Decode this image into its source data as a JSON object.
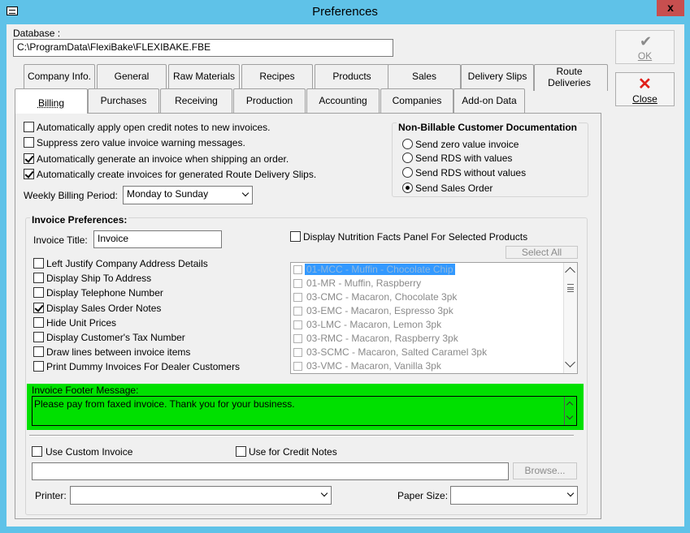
{
  "window": {
    "title": "Preferences",
    "close_glyph": "x"
  },
  "database": {
    "label": "Database :",
    "path": "C:\\ProgramData\\FlexiBake\\FLEXIBAKE.FBE"
  },
  "buttons": {
    "ok_label": "OK",
    "close_label": "Close",
    "select_all": "Select All",
    "browse": "Browse..."
  },
  "tabs_row1": [
    "Company Info.",
    "General",
    "Raw Materials",
    "Recipes",
    "Products",
    "Sales",
    "Delivery Slips",
    "Route Deliveries"
  ],
  "tabs_row2": [
    "Billing",
    "Purchases",
    "Receiving",
    "Production",
    "Accounting",
    "Companies",
    "Add-on Data"
  ],
  "billing": {
    "options": [
      {
        "label": "Automatically apply open credit notes to new invoices.",
        "checked": false
      },
      {
        "label": "Suppress zero value invoice warning messages.",
        "checked": false
      },
      {
        "label": "Automatically generate an invoice when shipping an order.",
        "checked": true
      },
      {
        "label": "Automatically create invoices for generated Route Delivery Slips.",
        "checked": true
      }
    ],
    "weekly_period_label": "Weekly Billing Period:",
    "weekly_period_value": "Monday to Sunday"
  },
  "non_billable": {
    "title": "Non-Billable Customer Documentation",
    "options": [
      {
        "label": "Send zero value invoice",
        "selected": false
      },
      {
        "label": "Send RDS with values",
        "selected": false
      },
      {
        "label": "Send RDS without values",
        "selected": false
      },
      {
        "label": "Send Sales Order",
        "selected": true
      }
    ]
  },
  "invoice_prefs": {
    "title": "Invoice Preferences:",
    "invoice_title_label": "Invoice Title:",
    "invoice_title_value": "Invoice",
    "options": [
      {
        "label": "Left Justify Company Address Details",
        "checked": false
      },
      {
        "label": "Display Ship To Address",
        "checked": false
      },
      {
        "label": "Display Telephone Number",
        "checked": false
      },
      {
        "label": "Display Sales Order Notes",
        "checked": true
      },
      {
        "label": "Hide Unit Prices",
        "checked": false
      },
      {
        "label": "Display Customer's Tax Number",
        "checked": false
      },
      {
        "label": "Draw lines between invoice items",
        "checked": false
      },
      {
        "label": "Print Dummy Invoices For Dealer Customers",
        "checked": false
      }
    ],
    "nutrition_label": "Display Nutrition Facts Panel For Selected Products",
    "nutrition_checked": false,
    "products": [
      {
        "label": "01-MCC - Muffin - Chocolate Chip",
        "selected": true
      },
      {
        "label": "01-MR - Muffin, Raspberry",
        "selected": false
      },
      {
        "label": "03-CMC - Macaron, Chocolate 3pk",
        "selected": false
      },
      {
        "label": "03-EMC - Macaron, Espresso 3pk",
        "selected": false
      },
      {
        "label": "03-LMC - Macaron, Lemon 3pk",
        "selected": false
      },
      {
        "label": "03-RMC - Macaron, Raspberry 3pk",
        "selected": false
      },
      {
        "label": "03-SCMC - Macaron, Salted Caramel 3pk",
        "selected": false
      },
      {
        "label": "03-VMC - Macaron, Vanilla 3pk",
        "selected": false
      }
    ],
    "footer_label": "Invoice Footer Message:",
    "footer_message": "Please pay from faxed invoice. Thank you for your business.",
    "footer_color": "#00e000"
  },
  "custom_invoice": {
    "use_custom_label": "Use Custom Invoice",
    "use_credit_label": "Use for Credit Notes",
    "path_value": "",
    "printer_label": "Printer:",
    "printer_value": "",
    "paper_size_label": "Paper Size:",
    "paper_size_value": ""
  },
  "colors": {
    "titlebar": "#5fc2e8",
    "close_button": "#c74f4f",
    "ok_check": "#8a8a8a",
    "close_x": "#e0211b",
    "selection": "#3399ff"
  }
}
